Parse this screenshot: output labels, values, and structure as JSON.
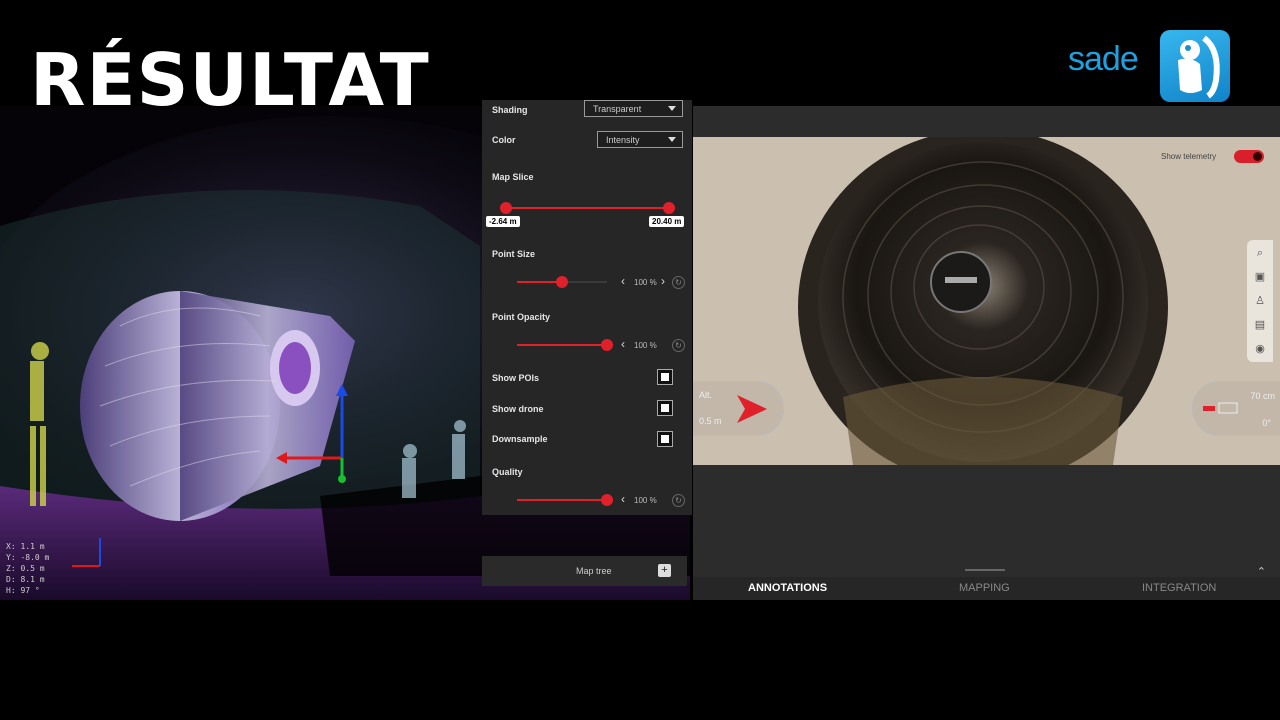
{
  "headline": "RÉSULTAT",
  "brand": {
    "text": "sade"
  },
  "panel": {
    "shading": {
      "label": "Shading",
      "value": "Transparent"
    },
    "color": {
      "label": "Color",
      "value": "Intensity"
    },
    "map_slice": {
      "label": "Map Slice",
      "min": "-2.64 m",
      "max": "20.40 m"
    },
    "point_size": {
      "label": "Point Size",
      "value": "100 %",
      "level": 0.5
    },
    "point_opacity": {
      "label": "Point Opacity",
      "value": "100 %",
      "level": 1.0
    },
    "show_pois": {
      "label": "Show POIs"
    },
    "show_drone": {
      "label": "Show drone"
    },
    "downsample": {
      "label": "Downsample"
    },
    "quality": {
      "label": "Quality",
      "value": "100 %",
      "level": 1.0
    }
  },
  "map_tree": {
    "label": "Map tree",
    "add": "+"
  },
  "coords": {
    "x": "X:     1.1 m",
    "y": "Y:  -8.0 m",
    "z": "Z:     0.5 m",
    "d": "D:     8.1 m",
    "h": "H:      97 °"
  },
  "video": {
    "telemetry_label": "Show telemetry",
    "hud_left_top": "Alt.",
    "hud_left_bottom": "0.5 m",
    "hud_right_top": "70 cm",
    "hud_right_bottom": "0°"
  },
  "tabs": [
    "ANNOTATIONS",
    "MAPPING",
    "INTEGRATION"
  ],
  "colors": {
    "accent": "#e0202a",
    "brand_blue": "#1aa3e0"
  }
}
